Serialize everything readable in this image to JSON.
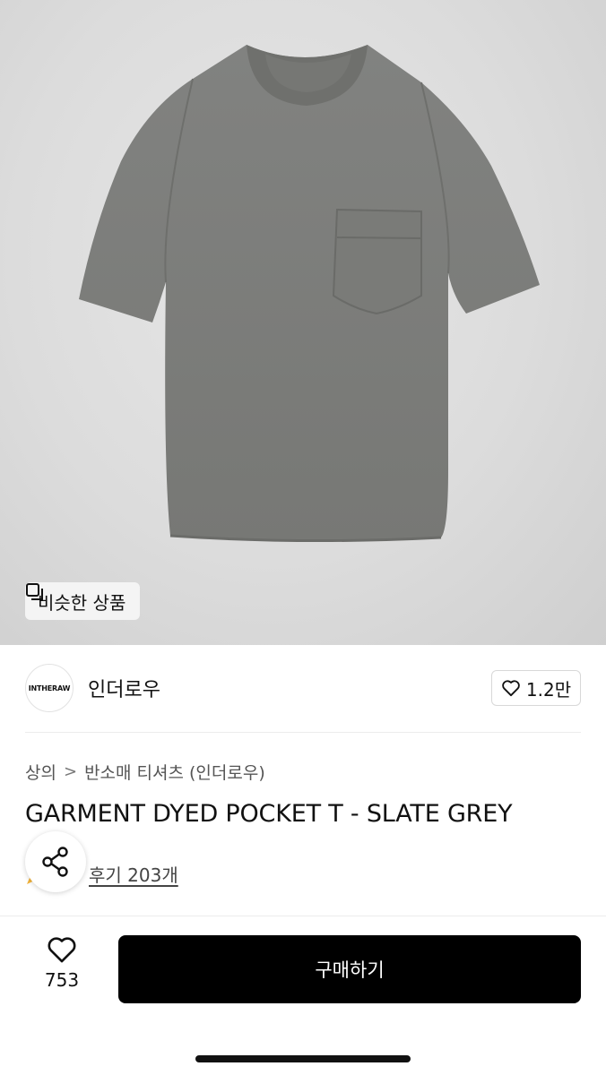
{
  "hero": {
    "image_alt": "grey pocket t-shirt",
    "similar_button_label": "비슷한 상품"
  },
  "brand": {
    "logo_text": "INTHERAW",
    "name": "인더로우",
    "favorite_count": "1.2만"
  },
  "breadcrumb": {
    "items": [
      "상의",
      "반소매 티셔츠 (인더로우)"
    ],
    "separator": ">"
  },
  "product": {
    "title": "GARMENT DYED POCKET T - SLATE GREY",
    "review_label": "후기 203개"
  },
  "bottom_bar": {
    "like_count": "753",
    "buy_label": "구매하기"
  },
  "colors": {
    "buy_button": "#000000",
    "shirt": "#7e7f7b",
    "background": "#dcdcdc"
  }
}
